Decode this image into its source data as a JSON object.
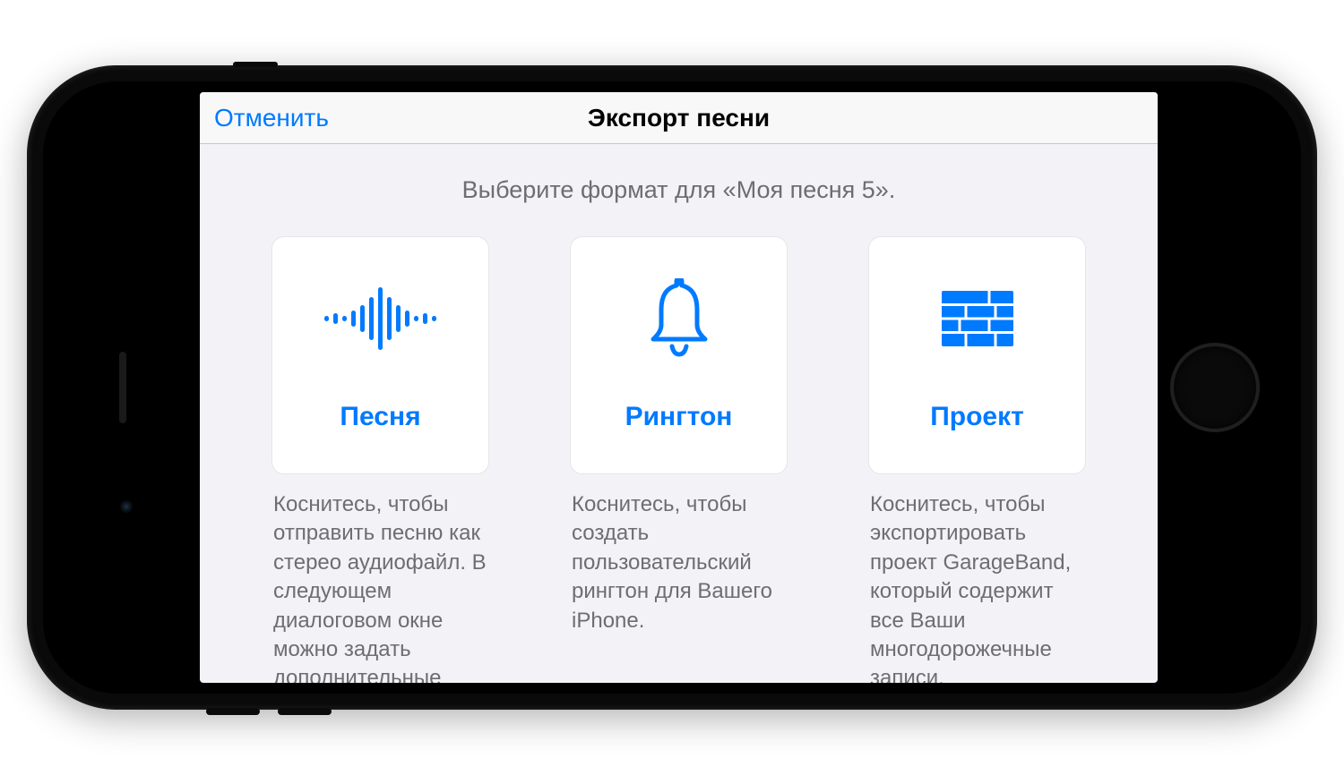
{
  "header": {
    "cancel_label": "Отменить",
    "title": "Экспорт песни"
  },
  "subtitle": "Выберите формат для «Моя песня 5».",
  "options": [
    {
      "id": "song",
      "label": "Песня",
      "icon": "waveform-icon",
      "description": "Коснитесь, чтобы отправить песню как стерео аудиофайл. В следующем диалоговом окне можно задать дополнительные"
    },
    {
      "id": "ringtone",
      "label": "Рингтон",
      "icon": "bell-icon",
      "description": "Коснитесь, чтобы создать пользовательский рингтон для Вашего iPhone."
    },
    {
      "id": "project",
      "label": "Проект",
      "icon": "bricks-icon",
      "description": "Коснитесь, чтобы экспортировать проект GarageBand, который содержит все Ваши многодорожечные записи."
    }
  ],
  "colors": {
    "accent": "#007aff",
    "background": "#f2f2f7",
    "secondaryText": "#6d6d72"
  }
}
